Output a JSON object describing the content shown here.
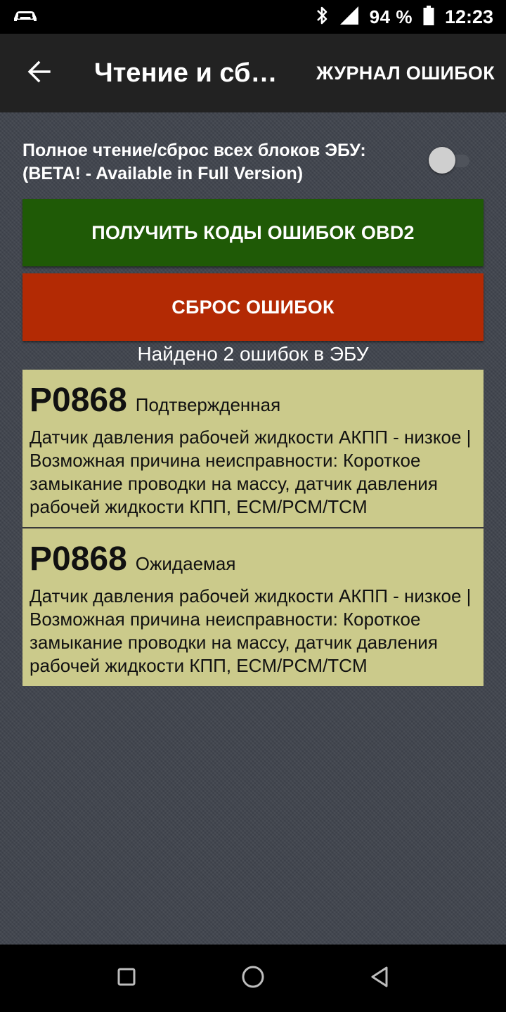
{
  "status_bar": {
    "battery": "94 %",
    "time": "12:23"
  },
  "app_bar": {
    "title": "Чтение и сброс ошибок",
    "action": "ЖУРНАЛ ОШИБОК"
  },
  "toggle": {
    "line1": "Полное чтение/сброс всех блоков ЭБУ:",
    "line2": "(BETA! - Available in Full Version)",
    "checked": false
  },
  "buttons": {
    "read": "ПОЛУЧИТЬ КОДЫ ОШИБОК OBD2",
    "reset": "СБРОС ОШИБОК"
  },
  "found_text": "Найдено 2 ошибок в ЭБУ",
  "codes": [
    {
      "code": "P0868",
      "status": "Подтвержденная",
      "description": "Датчик давления рабочей жидкости АКПП - низкое | Возможная причина неисправности: Короткое замыкание проводки на массу, датчик давления рабочей жидкости КПП, ECM/PCM/TCM"
    },
    {
      "code": "P0868",
      "status": "Ожидаемая",
      "description": "Датчик давления рабочей жидкости АКПП - низкое | Возможная причина неисправности: Короткое замыкание проводки на массу, датчик давления рабочей жидкости КПП, ECM/PCM/TCM"
    }
  ],
  "icons": {
    "status_left": "car-icon",
    "bluetooth": "bluetooth-icon",
    "signal": "signal-icon",
    "battery": "battery-icon",
    "back": "arrow-back-icon",
    "nav_recents": "square-icon",
    "nav_home": "circle-icon",
    "nav_back": "triangle-back-icon"
  },
  "colors": {
    "read_button": "#1f5a06",
    "reset_button": "#b32a04",
    "codes_background": "#cbca8b",
    "app_bar": "#222222"
  }
}
